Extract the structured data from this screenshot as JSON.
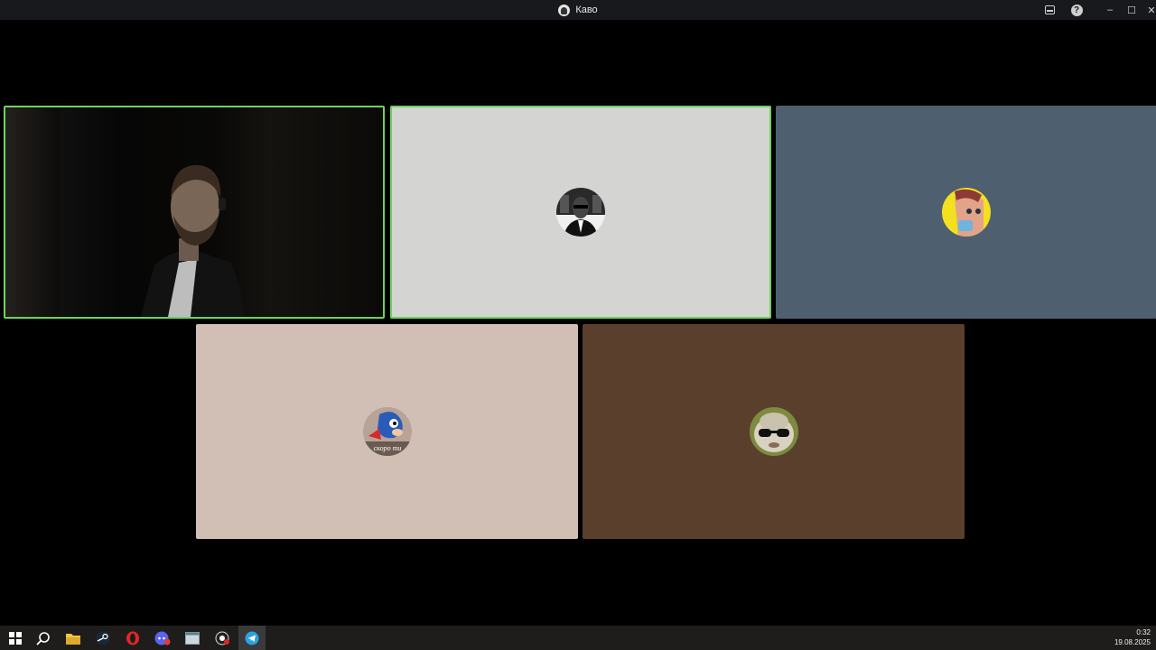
{
  "window": {
    "title": "Каво",
    "buttons": {
      "minimize": "–",
      "maximize": "☐",
      "close": "✕",
      "help": "?"
    }
  },
  "call": {
    "participants": [
      {
        "id": "p1",
        "kind": "camera",
        "speaking": true,
        "bg": "#050505"
      },
      {
        "id": "p2",
        "kind": "avatar",
        "speaking": true,
        "bg": "#d4d4d3",
        "avatar": "man-in-suit-avatar"
      },
      {
        "id": "p3",
        "kind": "avatar",
        "speaking": false,
        "bg": "#4e5f6f",
        "avatar": "cartoon-face-avatar"
      },
      {
        "id": "p4",
        "kind": "avatar",
        "speaking": false,
        "bg": "#d1beb5",
        "avatar": "sonic-avatar",
        "avatar_text": "скоро ти"
      },
      {
        "id": "p5",
        "kind": "avatar",
        "speaking": false,
        "bg": "#5a3f2c",
        "avatar": "sunglasses-creature-avatar"
      }
    ]
  },
  "taskbar": {
    "apps": [
      {
        "name": "start-button",
        "icon": "windows-logo-icon"
      },
      {
        "name": "search-button",
        "icon": "search-icon"
      },
      {
        "name": "file-explorer",
        "icon": "folder-icon"
      },
      {
        "name": "steam",
        "icon": "steam-icon"
      },
      {
        "name": "opera",
        "icon": "opera-icon"
      },
      {
        "name": "discord",
        "icon": "discord-icon"
      },
      {
        "name": "app-window",
        "icon": "window-icon"
      },
      {
        "name": "recorder",
        "icon": "record-icon"
      },
      {
        "name": "telegram",
        "icon": "telegram-icon",
        "active": true
      }
    ],
    "clock": {
      "time": "0:32",
      "date": "19.08.2025"
    }
  }
}
